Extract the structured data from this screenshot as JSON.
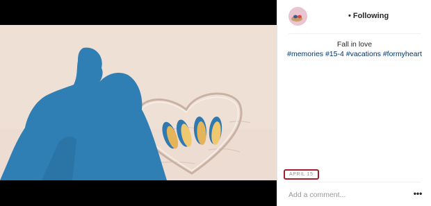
{
  "post": {
    "photo_name": "beach-shadow-heart-photo",
    "colors": {
      "sand": "#efe0d6",
      "shadow": "#2f7fb4",
      "sandal_strap": "#2f79b0",
      "sandal_sole": "#e3b45a",
      "letterbox": "#000000"
    }
  },
  "header": {
    "follow_status": "Following",
    "bullet": "•"
  },
  "caption": {
    "text": "Fall in love",
    "hashtags": "#memories #15-4 #vacations #formyheart"
  },
  "date": {
    "label": "APRIL 15",
    "highlight_color": "#a51e2a"
  },
  "comment": {
    "placeholder": "Add a comment...",
    "more_icon": "ellipsis-icon",
    "more_label": "•••"
  }
}
